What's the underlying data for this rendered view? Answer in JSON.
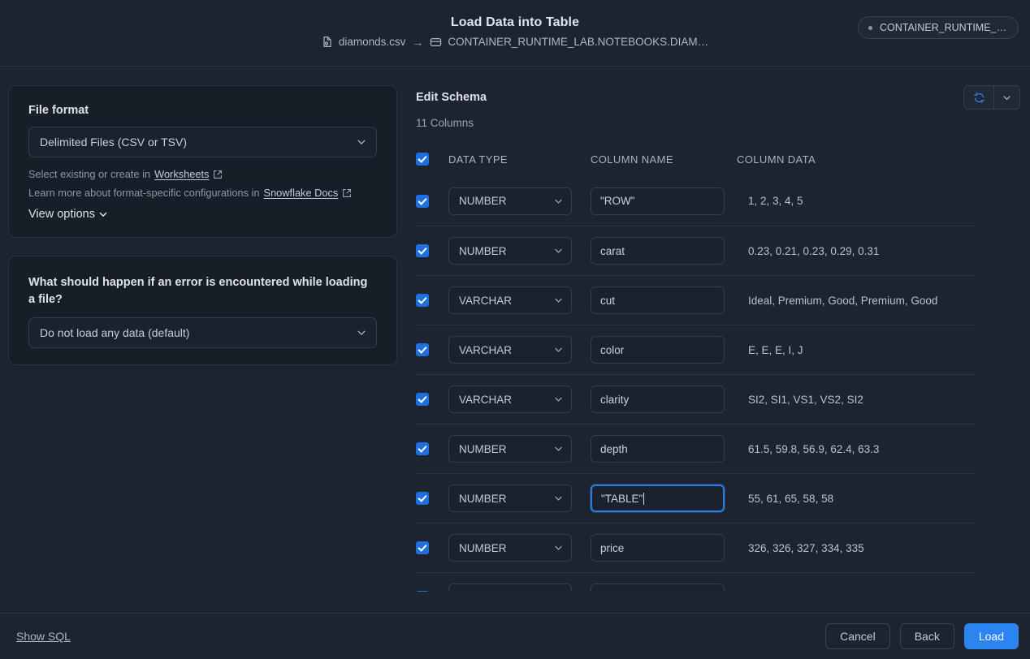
{
  "header": {
    "title": "Load Data into Table",
    "source_file": "diamonds.csv",
    "arrow": "→",
    "target_table": "CONTAINER_RUNTIME_LAB.NOTEBOOKS.DIAM…",
    "env_badge": "CONTAINER_RUNTIME_…"
  },
  "file_format_card": {
    "label": "File format",
    "selected": "Delimited Files (CSV or TSV)",
    "hint1_prefix": "Select existing or create in",
    "hint1_link": "Worksheets",
    "hint2_prefix": "Learn more about format-specific configurations in",
    "hint2_link": "Snowflake Docs",
    "view_options": "View options"
  },
  "error_card": {
    "question": "What should happen if an error is encountered while loading a file?",
    "selected": "Do not load any data (default)"
  },
  "schema": {
    "title": "Edit Schema",
    "column_count": "11 Columns",
    "headers": {
      "data_type": "DATA TYPE",
      "column_name": "COLUMN NAME",
      "column_data": "COLUMN DATA"
    },
    "rows": [
      {
        "checked": true,
        "type": "NUMBER",
        "name": "\"ROW\"",
        "data": "1, 2, 3, 4, 5",
        "focused": false
      },
      {
        "checked": true,
        "type": "NUMBER",
        "name": "carat",
        "data": "0.23, 0.21, 0.23, 0.29, 0.31",
        "focused": false
      },
      {
        "checked": true,
        "type": "VARCHAR",
        "name": "cut",
        "data": "Ideal, Premium, Good, Premium, Good",
        "focused": false
      },
      {
        "checked": true,
        "type": "VARCHAR",
        "name": "color",
        "data": "E, E, E, I, J",
        "focused": false
      },
      {
        "checked": true,
        "type": "VARCHAR",
        "name": "clarity",
        "data": "SI2, SI1, VS1, VS2, SI2",
        "focused": false
      },
      {
        "checked": true,
        "type": "NUMBER",
        "name": "depth",
        "data": "61.5, 59.8, 56.9, 62.4, 63.3",
        "focused": false
      },
      {
        "checked": true,
        "type": "NUMBER",
        "name": "\"TABLE\"",
        "data": "55, 61, 65, 58, 58",
        "focused": true
      },
      {
        "checked": true,
        "type": "NUMBER",
        "name": "price",
        "data": "326, 326, 327, 334, 335",
        "focused": false
      },
      {
        "checked": true,
        "type": "",
        "name": "",
        "data": "",
        "focused": false
      }
    ]
  },
  "footer": {
    "show_sql": "Show SQL",
    "cancel": "Cancel",
    "back": "Back",
    "load": "Load"
  },
  "colors": {
    "accent": "#2b84f0",
    "checkbox": "#1f6fe0",
    "focus_ring": "#2b7de0",
    "page_bg": "#1e242f",
    "card_bg": "#181e28"
  }
}
